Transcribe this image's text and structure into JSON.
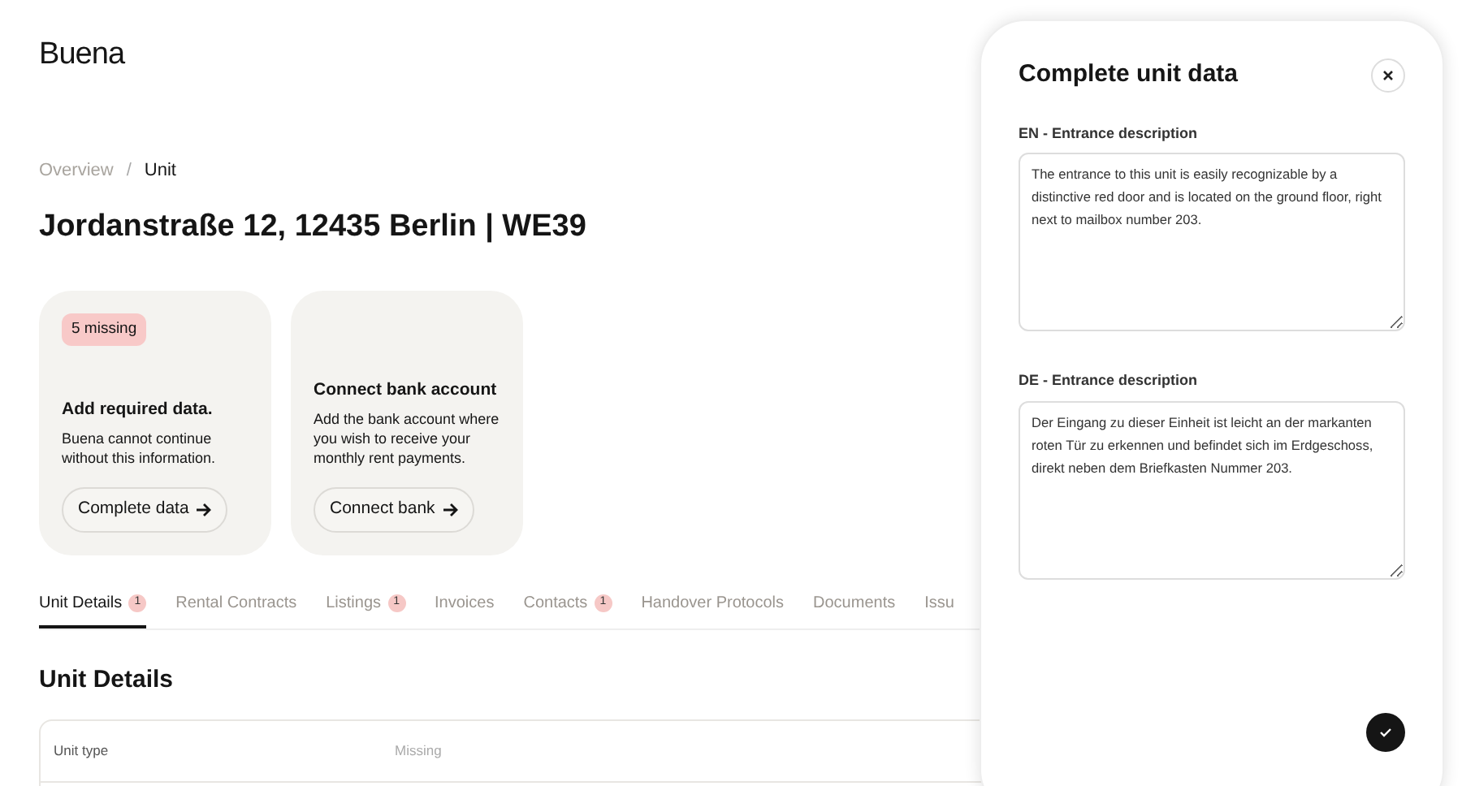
{
  "logo": "Buena",
  "breadcrumb": [
    {
      "label": "Overview",
      "selected": false
    },
    {
      "label": "Unit",
      "selected": true
    }
  ],
  "breadcrumb_separator": "/",
  "title": "Jordanstraße 12, 12435 Berlin | WE39",
  "cards": [
    {
      "badge": "5 missing",
      "heading": "Add required data.",
      "text": "Buena cannot continue without this information.",
      "button": "Complete data"
    },
    {
      "heading": "Connect bank account",
      "text": "Add the bank account where you wish to receive your monthly rent payments.",
      "button": "Connect bank"
    }
  ],
  "tabs": [
    {
      "label": "Unit Details",
      "count": "1",
      "selected": true
    },
    {
      "label": "Rental Contracts",
      "selected": false
    },
    {
      "label": "Listings",
      "count": "1",
      "selected": false
    },
    {
      "label": "Invoices",
      "selected": false
    },
    {
      "label": "Contacts",
      "count": "1",
      "selected": false
    },
    {
      "label": "Handover Protocols",
      "selected": false
    },
    {
      "label": "Documents",
      "selected": false
    },
    {
      "label": "Issu",
      "selected": false
    }
  ],
  "section_title": "Unit Details",
  "table": {
    "rows": [
      {
        "label": "Unit type",
        "value": "Missing",
        "missing": true
      }
    ]
  },
  "panel": {
    "title": "Complete unit data",
    "fields": [
      {
        "label": "EN - Entrance description",
        "value": "The entrance to this unit is easily recognizable by a distinctive red door and is located on the ground floor, right next to mailbox number 203."
      },
      {
        "label": "DE - Entrance description",
        "value": "Der Eingang zu dieser Einheit ist leicht an der markanten roten Tür zu erkennen und befindet sich im Erdgeschoss, direkt neben dem Briefkasten Nummer 203."
      }
    ]
  }
}
